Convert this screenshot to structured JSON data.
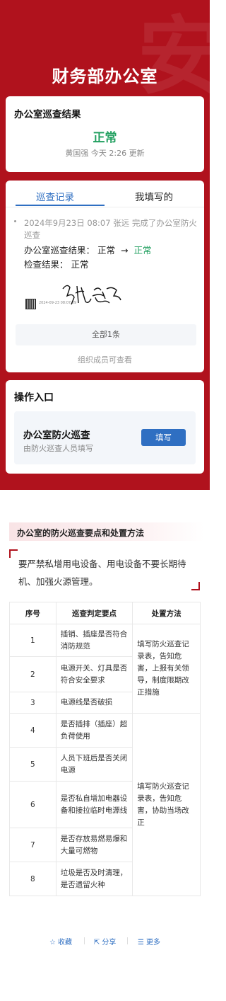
{
  "hero": {
    "title": "财务部办公室",
    "watermark": "安"
  },
  "result_card": {
    "title": "办公室巡查结果",
    "status": "正常",
    "meta": "黄国强 今天 2:26 更新"
  },
  "record_card": {
    "tabs": [
      "巡查记录",
      "我填写的"
    ],
    "record": {
      "header": "2024年9月23日 08:07 张远 完成了办公室防火巡查",
      "line1_label": "办公室巡查结果：",
      "line1_before": "正常",
      "line1_arrow": "→",
      "line1_after": "正常",
      "line2": "检查结果： 正常",
      "signature": "张远",
      "qr_caption": "2024-09-23 08:07:09"
    },
    "all_button": "全部1条",
    "visible_note": "组织成员可查看"
  },
  "ops_card": {
    "title": "操作入口",
    "item_name": "办公室防火巡查",
    "item_desc": "由防火巡查人员填写",
    "fill_button": "填写"
  },
  "section": {
    "title": "办公室的防火巡查要点和处置方法",
    "intro": "要严禁私增用电设备、用电设备不要长期待机、加强火源管理。"
  },
  "table": {
    "headers": [
      "序号",
      "巡查判定要点",
      "处置方法"
    ],
    "rows": [
      {
        "no": "1",
        "point": "插销、插座是否符合消防规范"
      },
      {
        "no": "2",
        "point": "电源开关、灯具是否符合安全要求"
      },
      {
        "no": "3",
        "point": "电源线是否破损"
      },
      {
        "no": "4",
        "point": "是否插排（插座）超负荷使用"
      },
      {
        "no": "5",
        "point": "人员下班后是否关闭电源"
      },
      {
        "no": "6",
        "point": "是否私自增加电器设备和接拉临时电源线"
      },
      {
        "no": "7",
        "point": "是否存放易燃易爆和大量可燃物"
      },
      {
        "no": "8",
        "point": "垃圾是否及时清理，是否遗留火种"
      }
    ],
    "method_a": "填写防火巡查记录表，告知危害，上报有关领导，制度限期改正措施",
    "method_b": "填写防火巡查记录表，告知危害，协助当场改正"
  },
  "footer": {
    "favorite": "收藏",
    "share": "分享",
    "more": "更多"
  },
  "colors": {
    "brand_red": "#b0121d",
    "accent_blue": "#2f6fc2",
    "ok_green": "#22a060"
  }
}
